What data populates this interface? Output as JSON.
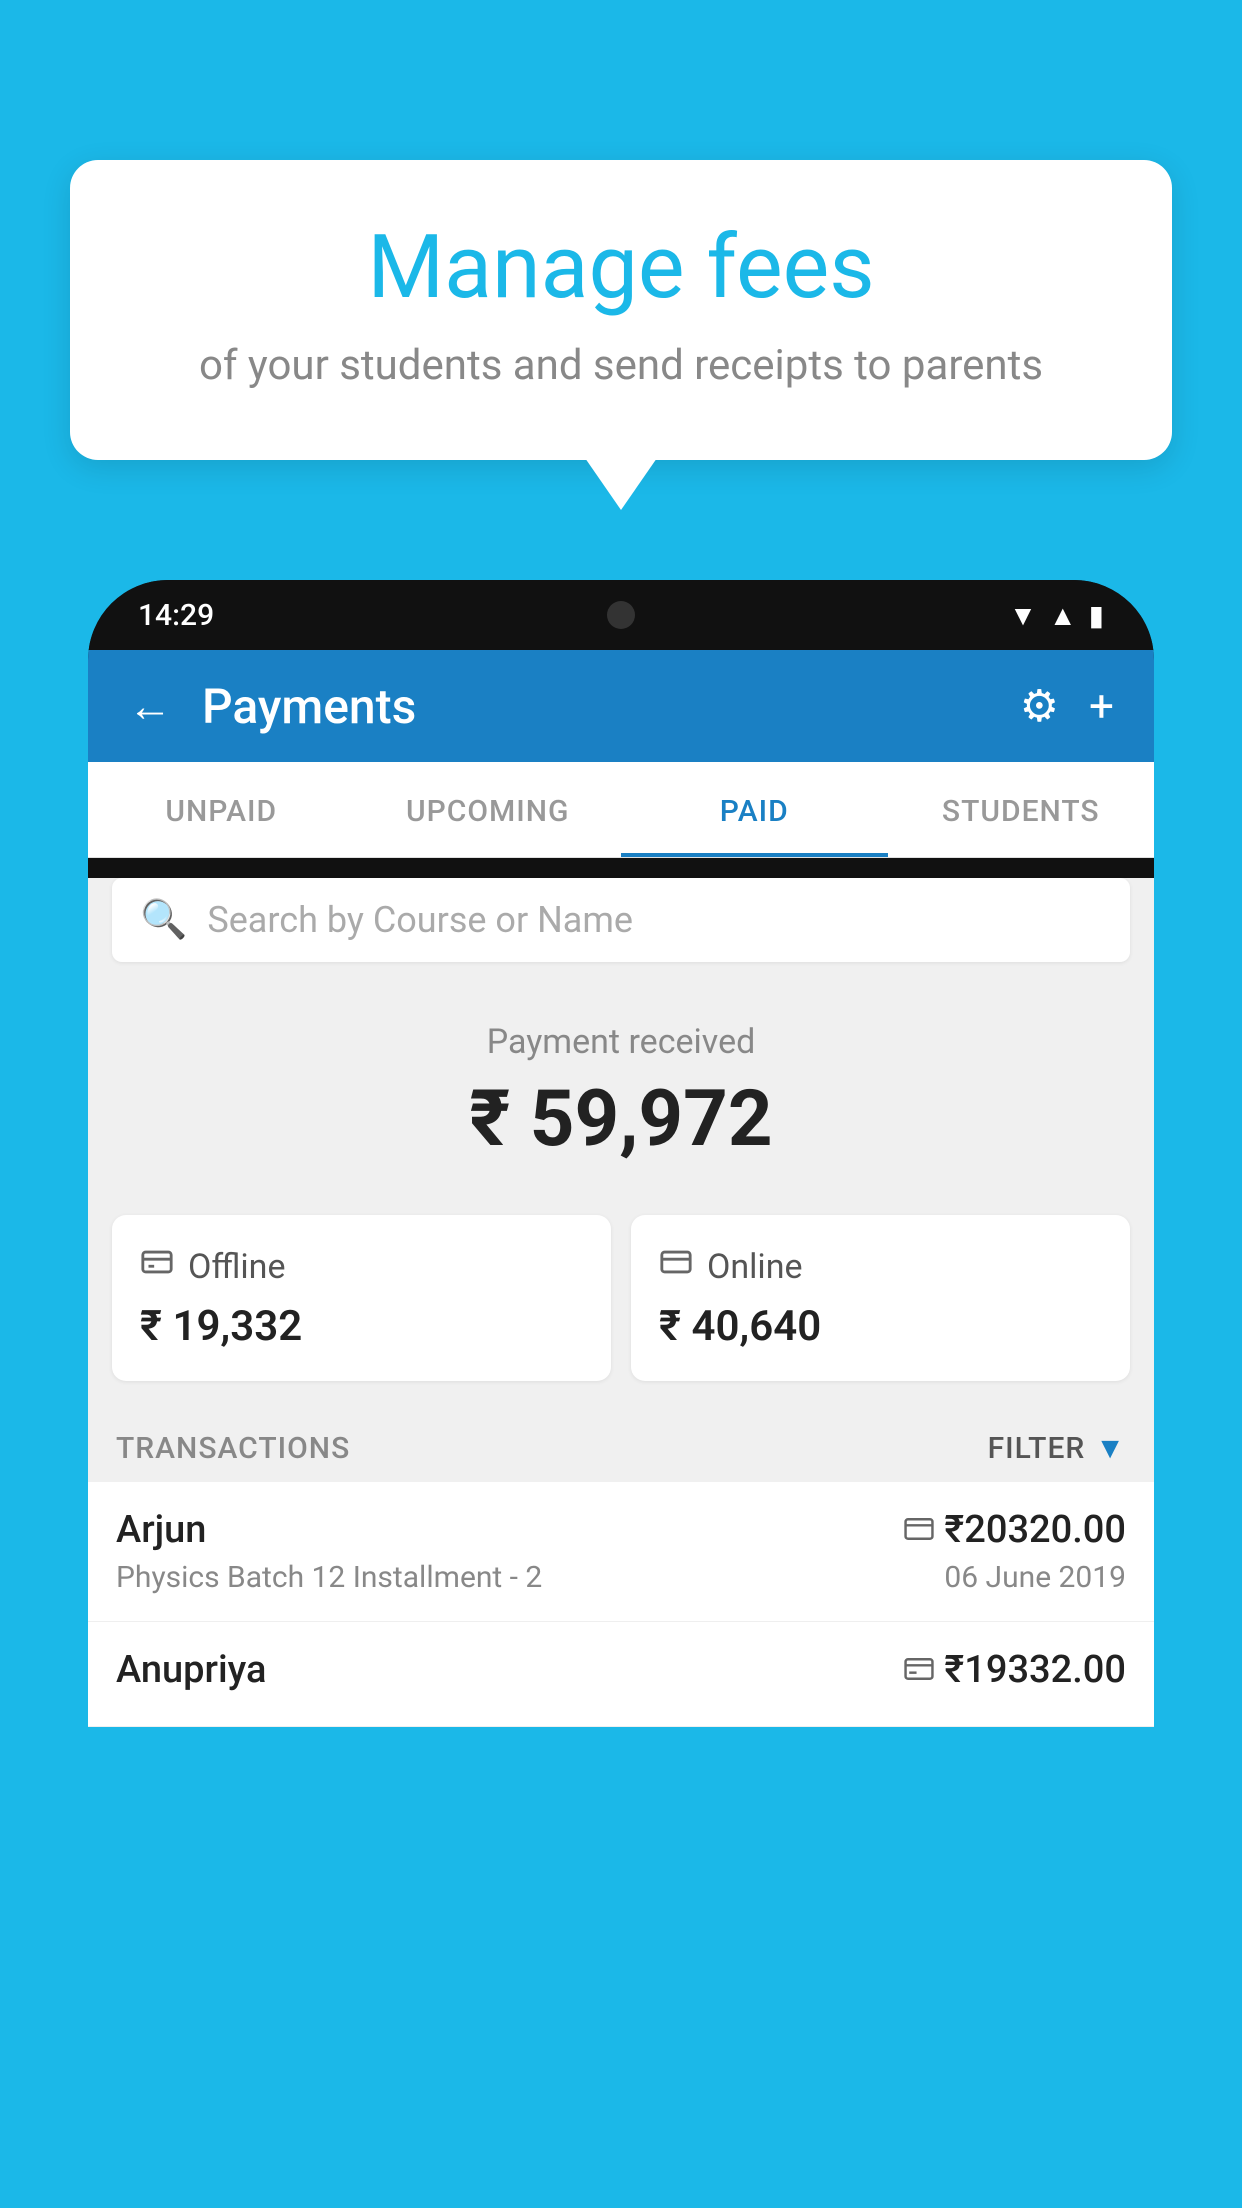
{
  "background_color": "#1bb8e8",
  "bubble": {
    "title": "Manage fees",
    "subtitle": "of your students and send receipts to parents"
  },
  "phone": {
    "status_time": "14:29",
    "header": {
      "title": "Payments",
      "back_label": "←",
      "settings_icon": "⚙",
      "add_icon": "+"
    },
    "tabs": [
      {
        "label": "UNPAID",
        "active": false
      },
      {
        "label": "UPCOMING",
        "active": false
      },
      {
        "label": "PAID",
        "active": true
      },
      {
        "label": "STUDENTS",
        "active": false
      }
    ],
    "search": {
      "placeholder": "Search by Course or Name"
    },
    "payment_received": {
      "label": "Payment received",
      "amount": "₹ 59,972"
    },
    "offline_card": {
      "icon": "💳",
      "label": "Offline",
      "amount": "₹ 19,332"
    },
    "online_card": {
      "icon": "💳",
      "label": "Online",
      "amount": "₹ 40,640"
    },
    "transactions_label": "TRANSACTIONS",
    "filter_label": "FILTER",
    "transactions": [
      {
        "name": "Arjun",
        "amount": "₹20320.00",
        "course": "Physics Batch 12 Installment - 2",
        "date": "06 June 2019",
        "payment_type": "online"
      },
      {
        "name": "Anupriya",
        "amount": "₹19332.00",
        "course": "",
        "date": "",
        "payment_type": "offline"
      }
    ]
  }
}
